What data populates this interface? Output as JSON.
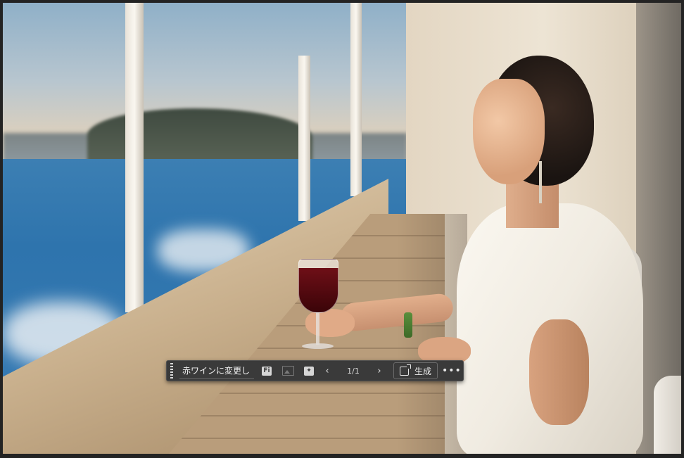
{
  "canvas": {
    "description_icons": [
      "sea-view-photo"
    ]
  },
  "taskbar": {
    "prompt_value": "赤ワインに変更し",
    "icons": {
      "grip": "grip-handle-icon",
      "firefly": "firefly-icon",
      "image": "image-icon",
      "sparkle": "generative-fill-icon",
      "prev": "chevron-left-icon",
      "next": "chevron-right-icon",
      "generate": "generate-icon",
      "more": "more-options-icon"
    },
    "firefly_label": "Fi",
    "prev_glyph": "‹",
    "next_glyph": "›",
    "page_count": "1/1",
    "generate_label": "生成",
    "more_glyph": "•••"
  }
}
